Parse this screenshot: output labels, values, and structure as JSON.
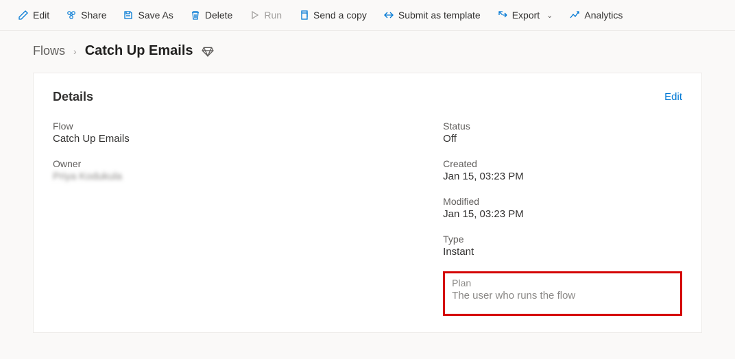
{
  "toolbar": {
    "edit": "Edit",
    "share": "Share",
    "saveAs": "Save As",
    "delete": "Delete",
    "run": "Run",
    "sendCopy": "Send a copy",
    "submitTemplate": "Submit as template",
    "export": "Export",
    "analytics": "Analytics"
  },
  "breadcrumb": {
    "root": "Flows",
    "current": "Catch Up Emails"
  },
  "card": {
    "title": "Details",
    "editLabel": "Edit"
  },
  "fields": {
    "flow": {
      "label": "Flow",
      "value": "Catch Up Emails"
    },
    "owner": {
      "label": "Owner",
      "value": "Priya Kodukula"
    },
    "status": {
      "label": "Status",
      "value": "Off"
    },
    "created": {
      "label": "Created",
      "value": "Jan 15, 03:23 PM"
    },
    "modified": {
      "label": "Modified",
      "value": "Jan 15, 03:23 PM"
    },
    "type": {
      "label": "Type",
      "value": "Instant"
    },
    "plan": {
      "label": "Plan",
      "value": "The user who runs the flow"
    }
  }
}
